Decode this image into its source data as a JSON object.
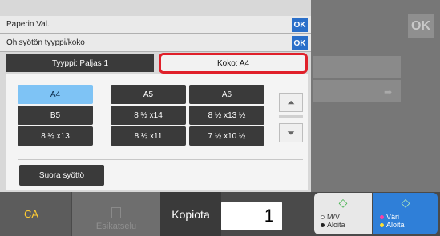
{
  "background": {
    "ok_label": "OK"
  },
  "dialog": {
    "title": "Paperin Val.",
    "title_ok": "OK",
    "subtitle": "Ohisyötön tyyppi/koko",
    "subtitle_ok": "OK",
    "tabs": {
      "type_label": "Tyyppi: Paljas 1",
      "size_label": "Koko: A4"
    },
    "sizes": [
      {
        "label": "A4",
        "selected": true
      },
      {
        "label": "A5",
        "selected": false
      },
      {
        "label": "A6",
        "selected": false
      },
      {
        "label": "B5",
        "selected": false
      },
      {
        "label": "8 ½ x14",
        "selected": false
      },
      {
        "label": "8 ½ x13 ½",
        "selected": false
      },
      {
        "label": "8 ½ x13",
        "selected": false
      },
      {
        "label": "8 ½ x11",
        "selected": false
      },
      {
        "label": "7 ½ x10 ½",
        "selected": false
      }
    ],
    "scroll_up_icon": "chevron-double-up",
    "scroll_down_icon": "chevron-double-down",
    "direct_feed_label": "Suora syöttö"
  },
  "bottom_bar": {
    "ca_label": "CA",
    "preview_label": "Esikatselu",
    "copies_label": "Kopiota",
    "copies_value": "1",
    "mono_start": {
      "line1": "M/V",
      "line2": "Aloita"
    },
    "color_start": {
      "line1": "Väri",
      "line2": "Aloita"
    }
  },
  "colors": {
    "accent_ok": "#2a6fc9",
    "selected_cell": "#7ec3f5",
    "highlight_border": "#e0202a",
    "color_start": "#2f7fd8",
    "ca_text": "#ffcc33"
  }
}
